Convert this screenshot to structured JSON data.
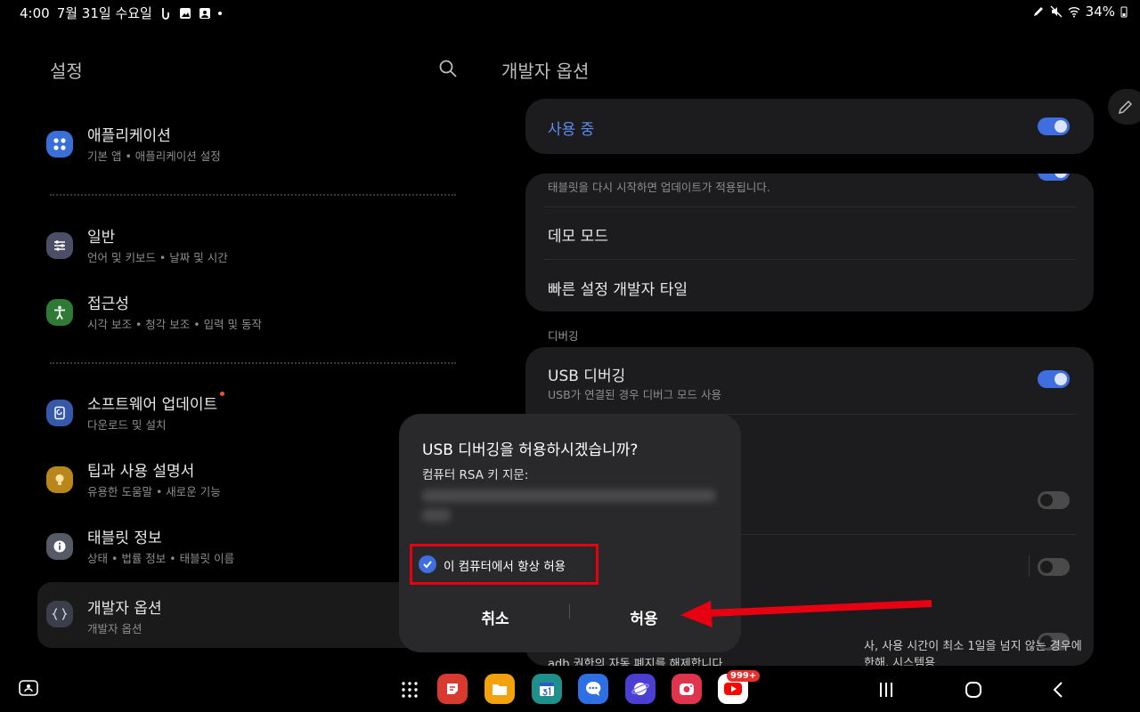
{
  "status_bar": {
    "time": "4:00",
    "date": "7월 31일 수요일",
    "battery": "34%"
  },
  "left_panel": {
    "title": "설정",
    "items": [
      {
        "title": "애플리케이션",
        "subtitle": "기본 앱 • 애플리케이션 설정",
        "icon": "apps-icon",
        "color": "#3a6fd8"
      },
      {
        "title": "일반",
        "subtitle": "언어 및 키보드 • 날짜 및 시간",
        "icon": "sliders-icon",
        "color": "#4a4f66"
      },
      {
        "title": "접근성",
        "subtitle": "시각 보조 • 청각 보조 • 입력 및 동작",
        "icon": "accessibility-icon",
        "color": "#2f7a34"
      },
      {
        "title": "소프트웨어 업데이트",
        "subtitle": "다운로드 및 설치",
        "icon": "update-icon",
        "color": "#3558a8"
      },
      {
        "title": "팁과 사용 설명서",
        "subtitle": "유용한 도움말 • 새로운 기능",
        "icon": "lightbulb-icon",
        "color": "#b8861b"
      },
      {
        "title": "태블릿 정보",
        "subtitle": "상태 • 법률 정보 • 태블릿 이름",
        "icon": "info-icon",
        "color": "#555a66"
      },
      {
        "title": "개발자 옵션",
        "subtitle": "개발자 옵션",
        "icon": "braces-icon",
        "color": "#3b3f4c"
      }
    ]
  },
  "right_panel": {
    "title": "개발자 옵션",
    "master_toggle": {
      "label": "사용 중",
      "on": true
    },
    "card1": {
      "partial_text": "태블릿을 다시 시작하면 업데이트가 적용됩니다.",
      "rows": [
        "데모 모드",
        "빠른 설정 개발자 타일"
      ]
    },
    "debug_section": "디버깅",
    "usb_debugging": {
      "label": "USB 디버깅",
      "desc": "USB가 연결된 경우 디버그 모드 사용",
      "on": true
    },
    "bottom_text_1": "사, 사용 시간이 최소 1일을 넘지 않는 경우에 한해, 시스템용",
    "bottom_text_2": "adb 권한의 자동 폐지를 해제합니다."
  },
  "dialog": {
    "title": "USB 디버깅을 허용하시겠습니까?",
    "subtitle": "컴퓨터 RSA 키 지문:",
    "checkbox_label": "이 컴퓨터에서 항상 허용",
    "checkbox_checked": true,
    "cancel": "취소",
    "allow": "허용"
  },
  "dock": {
    "badge": "999+"
  },
  "colors": {
    "accent": "#3e6ee0",
    "highlight": "#e60012"
  }
}
